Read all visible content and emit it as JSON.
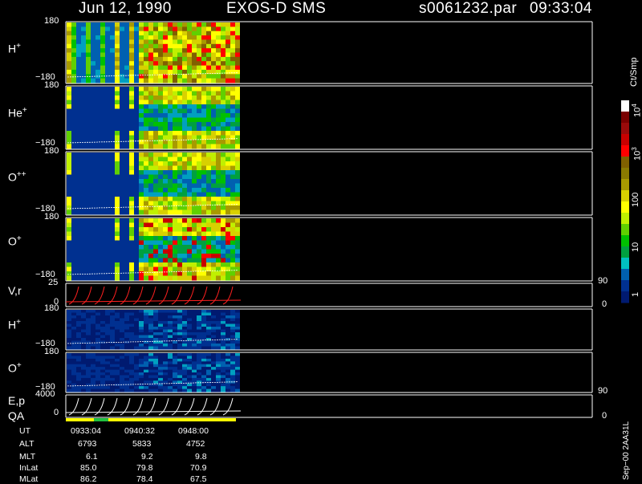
{
  "header": {
    "date": "Jun 12, 1990",
    "instrument": "EXOS-D SMS",
    "file": "s0061232.par",
    "time": "09:33:04"
  },
  "panels": [
    {
      "label": "H",
      "sup": "+",
      "ymax": "180",
      "ymin": "−180"
    },
    {
      "label": "He",
      "sup": "+",
      "ymax": "180",
      "ymin": "−180"
    },
    {
      "label": "O",
      "sup": "++",
      "ymax": "180",
      "ymin": "−180"
    },
    {
      "label": "O",
      "sup": "+",
      "ymax": "180",
      "ymin": "−180"
    },
    {
      "label": "V,r",
      "sup": "",
      "ymax": "25",
      "ymin": "0",
      "right_top": "90",
      "right_bottom": "0"
    },
    {
      "label": "H",
      "sup": "+",
      "ymax": "180",
      "ymin": "−180"
    },
    {
      "label": "O",
      "sup": "+",
      "ymax": "180",
      "ymin": "−180"
    },
    {
      "label": "E,p",
      "sup": "",
      "ymax": "4000",
      "ymin": "0",
      "right_top": "90",
      "right_bottom": "0"
    }
  ],
  "qa_label": "QA",
  "colorbar": {
    "unit": "Ct/Smp",
    "labels": [
      {
        "base": "10",
        "exp": "4"
      },
      {
        "base": "10",
        "exp": "3"
      },
      {
        "base": "100",
        "exp": ""
      },
      {
        "base": "10",
        "exp": ""
      },
      {
        "base": "1",
        "exp": ""
      }
    ],
    "colors": [
      "#ffffff",
      "#7a0000",
      "#9a0a0a",
      "#c80000",
      "#ff0000",
      "#806000",
      "#8a7a00",
      "#a89a00",
      "#d8d000",
      "#ffff00",
      "#c0f000",
      "#60d000",
      "#00c000",
      "#00a040",
      "#00c0c0",
      "#0060b0",
      "#003090",
      "#001a70"
    ]
  },
  "footer": {
    "rows": [
      {
        "name": "UT",
        "values": [
          "0933:04",
          "0940:32",
          "0948:00"
        ]
      },
      {
        "name": "ALT",
        "values": [
          "6793",
          "5833",
          "4752"
        ]
      },
      {
        "name": "MLT",
        "values": [
          "6.1",
          "9.2",
          "9.8"
        ]
      },
      {
        "name": "InLat",
        "values": [
          "85.0",
          "79.8",
          "70.9"
        ]
      },
      {
        "name": "MLat",
        "values": [
          "86.2",
          "78.4",
          "67.5"
        ]
      }
    ],
    "stamp": "Sep−00 2AA31L"
  }
}
